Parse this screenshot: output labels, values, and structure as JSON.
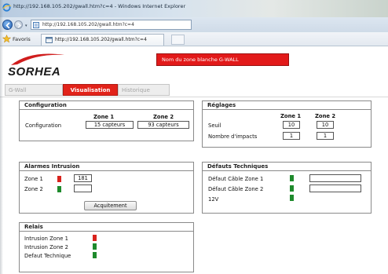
{
  "browser": {
    "title": "http://192.168.105.202/gwall.htm?c=4 - Windows Internet Explorer",
    "address": "http://192.168.105.202/gwall.htm?c=4",
    "favorites_label": "Favoris",
    "tab_label": "http://192.168.105.202/gwall.htm?c=4"
  },
  "header": {
    "logo_text": "SORHEA",
    "banner_text": "Nom du zone blanche G-WALL"
  },
  "nav": {
    "tabs": [
      "G-Wall",
      "Visualisation",
      "Historique"
    ],
    "active": "Visualisation"
  },
  "configuration": {
    "title": "Configuration",
    "zone1_header": "Zone 1",
    "zone2_header": "Zone 2",
    "row_label": "Configuration",
    "zone1_value": "15 capteurs",
    "zone2_value": "93 capteurs"
  },
  "reglages": {
    "title": "Réglages",
    "zone1_header": "Zone 1",
    "zone2_header": "Zone 2",
    "rows": [
      {
        "label": "Seuil",
        "zone1": "10",
        "zone2": "10"
      },
      {
        "label": "Nombre d'impacts",
        "zone1": "1",
        "zone2": "1"
      }
    ]
  },
  "alarmes": {
    "title": "Alarmes Intrusion",
    "rows": [
      {
        "label": "Zone 1",
        "status": "red",
        "value": "181"
      },
      {
        "label": "Zone 2",
        "status": "green",
        "value": ""
      }
    ],
    "ack_button": "Acquitement"
  },
  "defauts": {
    "title": "Défauts Techniques",
    "rows": [
      {
        "label": "Défaut Câble Zone 1",
        "status": "green",
        "value": ""
      },
      {
        "label": "Défaut Câble Zone 2",
        "status": "green",
        "value": ""
      },
      {
        "label": "12V",
        "status": "green"
      }
    ]
  },
  "relais": {
    "title": "Relais",
    "rows": [
      {
        "label": "Intrusion Zone 1",
        "status": "red"
      },
      {
        "label": "Intrusion Zone 2",
        "status": "green"
      },
      {
        "label": "Defaut Technique",
        "status": "green"
      }
    ]
  },
  "colors": {
    "accent_red": "#e2231a",
    "led_red": "#d9231d",
    "led_green": "#1e8a2c"
  }
}
